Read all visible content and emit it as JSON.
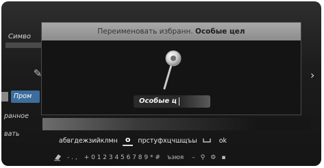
{
  "background": {
    "section_title": "Симво",
    "tab_chip": "Пром",
    "side_item_1": "ранное",
    "side_item_2": "вать"
  },
  "dialog": {
    "header_prefix": "Переименовать избранн.",
    "header_name": "Особые цел",
    "name_field_value": "Особые ц"
  },
  "keyboard": {
    "letters_left": "абвгдежзийклмн",
    "selected_letter": "о",
    "letters_right": "прстуфхцчшщъы",
    "ok_label": "ok",
    "symbols": "- . ,",
    "digits": "+ 0 1 2 3 4 5 6 7 8 9 * #",
    "case_label": "ъэюя"
  },
  "icons": {
    "pen": "pen-icon",
    "pin": "map-pin-icon",
    "trash": "delete-icon",
    "space": "space-icon",
    "arrow": "chevron-right-icon",
    "settings": "settings-icon"
  }
}
